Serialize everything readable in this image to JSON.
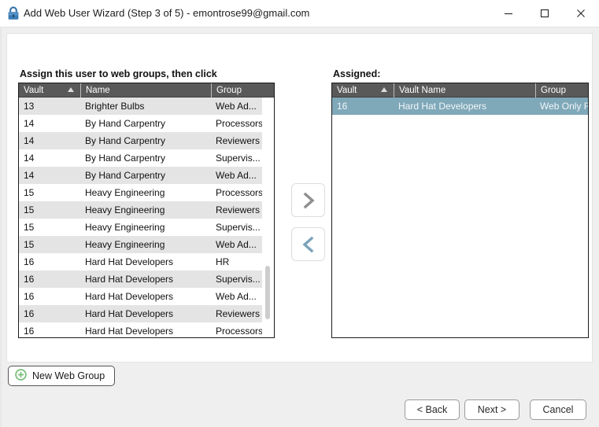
{
  "window": {
    "title": "Add Web User Wizard (Step 3 of 5) - emontrose99@gmail.com",
    "icon": "lock-icon",
    "controls": {
      "minimize": "—",
      "maximize": "□",
      "close": "✕"
    }
  },
  "main": {
    "instruction": "Assign this user to web groups, then click",
    "assigned_label": "Assigned:"
  },
  "available_list": {
    "columns": [
      "Vault",
      "Name",
      "Group"
    ],
    "sort_indicator": "ascending",
    "rows": [
      {
        "vault": "13",
        "name": "Brighter Bulbs",
        "group": "Web Ad..."
      },
      {
        "vault": "14",
        "name": "By Hand Carpentry",
        "group": "Processors"
      },
      {
        "vault": "14",
        "name": "By Hand Carpentry",
        "group": "Reviewers"
      },
      {
        "vault": "14",
        "name": "By Hand Carpentry",
        "group": "Supervis..."
      },
      {
        "vault": "14",
        "name": "By Hand Carpentry",
        "group": "Web Ad..."
      },
      {
        "vault": "15",
        "name": "Heavy Engineering",
        "group": "Processors"
      },
      {
        "vault": "15",
        "name": "Heavy Engineering",
        "group": "Reviewers"
      },
      {
        "vault": "15",
        "name": "Heavy Engineering",
        "group": "Supervis..."
      },
      {
        "vault": "15",
        "name": "Heavy Engineering",
        "group": "Web Ad..."
      },
      {
        "vault": "16",
        "name": "Hard Hat Developers",
        "group": "HR"
      },
      {
        "vault": "16",
        "name": "Hard Hat Developers",
        "group": "Supervis..."
      },
      {
        "vault": "16",
        "name": "Hard Hat Developers",
        "group": "Web Ad..."
      },
      {
        "vault": "16",
        "name": "Hard Hat Developers",
        "group": "Reviewers"
      },
      {
        "vault": "16",
        "name": "Hard Hat Developers",
        "group": "Processors"
      }
    ]
  },
  "assigned_list": {
    "columns": [
      "Vault",
      "Vault Name",
      "Group"
    ],
    "sort_indicator": "ascending",
    "rows": [
      {
        "vault": "16",
        "name": "Hard Hat Developers",
        "group": "Web Only R...",
        "selected": true
      }
    ]
  },
  "transfer": {
    "add_label": "›",
    "remove_label": "‹"
  },
  "buttons": {
    "new_group": "New Web Group",
    "back": "< Back",
    "next": "Next >",
    "cancel": "Cancel"
  },
  "colors": {
    "header_bg": "#595959",
    "selection": "#7fa8b9",
    "row_alt": "#e4e4e4",
    "add_arrow": "#8f8f8f",
    "remove_arrow": "#7ba3bb",
    "plus_green": "#6fbb6f"
  }
}
